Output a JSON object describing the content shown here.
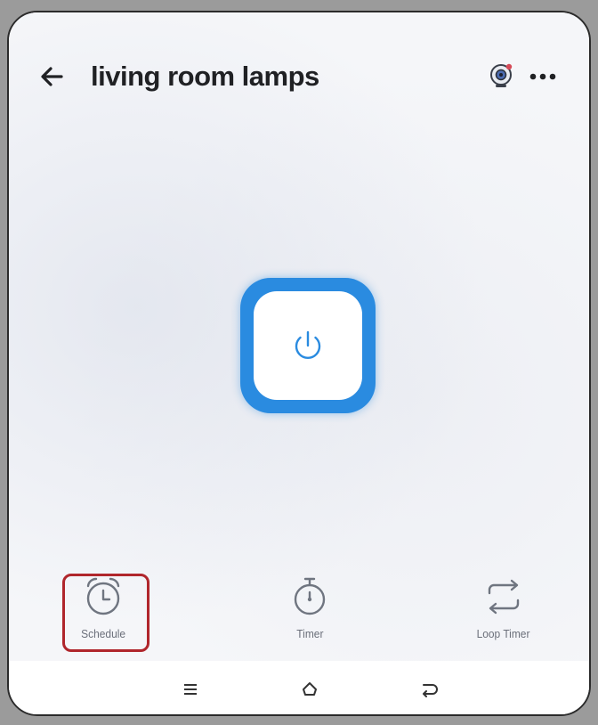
{
  "header": {
    "title": "living room lamps",
    "back_icon": "arrow-left-icon",
    "camera_icon": "camera-icon",
    "more_icon": "more-horizontal-icon"
  },
  "power": {
    "icon": "power-icon",
    "accent_color": "#2a8be0"
  },
  "actions": [
    {
      "label": "Schedule",
      "icon": "alarm-clock-icon"
    },
    {
      "label": "Timer",
      "icon": "stopwatch-icon"
    },
    {
      "label": "Loop Timer",
      "icon": "loop-icon"
    }
  ],
  "selection_color": "#b0262c",
  "system_nav": {
    "menu_icon": "recent-apps-icon",
    "home_icon": "home-icon",
    "back_icon": "system-back-icon"
  }
}
